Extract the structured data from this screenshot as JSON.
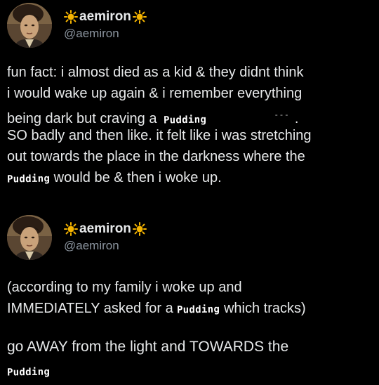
{
  "posts": [
    {
      "display_name": "aemiron",
      "handle": "@aemiron",
      "icons": {
        "avatar": "painted-portrait-avatar",
        "emoji": "sun-icon"
      },
      "line1": "fun fact: i almost died as a kid & they didnt think",
      "line2": "i would wake up again & i remember everything",
      "line3_pre": "being dark but craving a",
      "word": "Pudding",
      "line3_post": ".",
      "line4": "SO badly and then like. it felt like i was stretching",
      "line5": "out towards the place in the darkness where the",
      "line6_post": "would be & then i woke up."
    },
    {
      "display_name": "aemiron",
      "handle": "@aemiron",
      "icons": {
        "avatar": "painted-portrait-avatar",
        "emoji": "sun-icon"
      },
      "line1": "(according to my family i woke up and",
      "line2_pre": "IMMEDIATELY asked for a",
      "word": "Pudding",
      "line2_post": "which tracks)"
    }
  ],
  "caption": {
    "line1": "go AWAY from the light and TOWARDS the",
    "word": "Pudding"
  },
  "colors": {
    "background": "#000000",
    "text": "#e7e9ea",
    "handle": "#8b949e",
    "sun": "#f5b400"
  }
}
